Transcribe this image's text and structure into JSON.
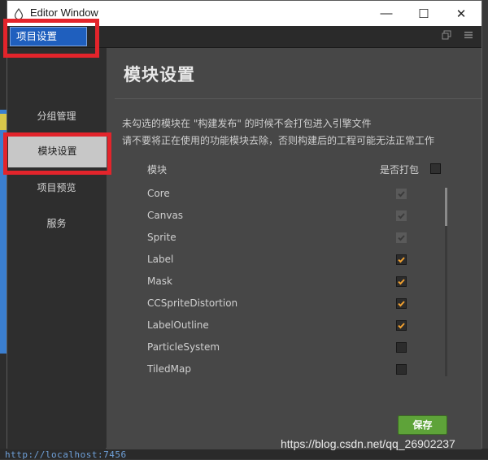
{
  "window": {
    "title": "Editor Window",
    "min_glyph": "—",
    "max_glyph": "☐",
    "close_glyph": "✕"
  },
  "tabs": [
    {
      "label": "项目设置"
    }
  ],
  "nav": {
    "items": [
      {
        "label": "分组管理"
      },
      {
        "label": "模块设置",
        "active": true
      },
      {
        "label": "项目预览"
      },
      {
        "label": "服务"
      }
    ]
  },
  "main": {
    "heading": "模块设置",
    "desc1": "未勾选的模块在 \"构建发布\" 的时候不会打包进入引擎文件",
    "desc2": "请不要将正在使用的功能模块去除，否则构建后的工程可能无法正常工作",
    "col_module": "模块",
    "col_pack": "是否打包",
    "modules": [
      {
        "name": "Core",
        "state": "checked-disabled"
      },
      {
        "name": "Canvas",
        "state": "checked-disabled"
      },
      {
        "name": "Sprite",
        "state": "checked-disabled"
      },
      {
        "name": "Label",
        "state": "checked"
      },
      {
        "name": "Mask",
        "state": "checked"
      },
      {
        "name": "CCSpriteDistortion",
        "state": "checked"
      },
      {
        "name": "LabelOutline",
        "state": "checked"
      },
      {
        "name": "ParticleSystem",
        "state": "unchecked"
      },
      {
        "name": "TiledMap",
        "state": "unchecked"
      }
    ],
    "save_label": "保存"
  },
  "watermark": "https://blog.csdn.net/qq_26902237",
  "background_url": "http://localhost:7456",
  "colors": {
    "accent": "#1f5fbe",
    "check": "#f0a030",
    "save": "#5ea339",
    "highlight": "#e3242b"
  }
}
